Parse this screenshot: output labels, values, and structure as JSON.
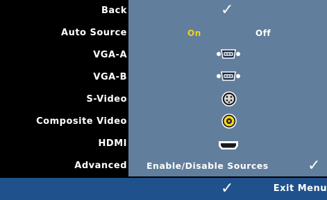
{
  "menu": {
    "items": [
      {
        "label": "Back"
      },
      {
        "label": "Auto Source"
      },
      {
        "label": "VGA-A"
      },
      {
        "label": "VGA-B"
      },
      {
        "label": "S-Video"
      },
      {
        "label": "Composite Video"
      },
      {
        "label": "HDMI"
      },
      {
        "label": "Advanced"
      }
    ],
    "exit_label": "Exit Menu"
  },
  "values": {
    "back_icon": "check-icon",
    "auto_source": {
      "on": "On",
      "off": "Off",
      "selected": "On"
    },
    "vga_a_icon": "vga-connector-icon",
    "vga_b_icon": "vga-connector-icon",
    "svideo_icon": "svideo-connector-icon",
    "composite_icon": "composite-connector-icon",
    "hdmi_icon": "hdmi-connector-icon",
    "advanced_text": "Enable/Disable Sources",
    "advanced_icon": "check-icon",
    "exit_icon": "check-icon"
  },
  "colors": {
    "panel": "#617e9c",
    "footer": "#1f528c",
    "highlight": "#f2d21f",
    "text": "#ffffff"
  }
}
